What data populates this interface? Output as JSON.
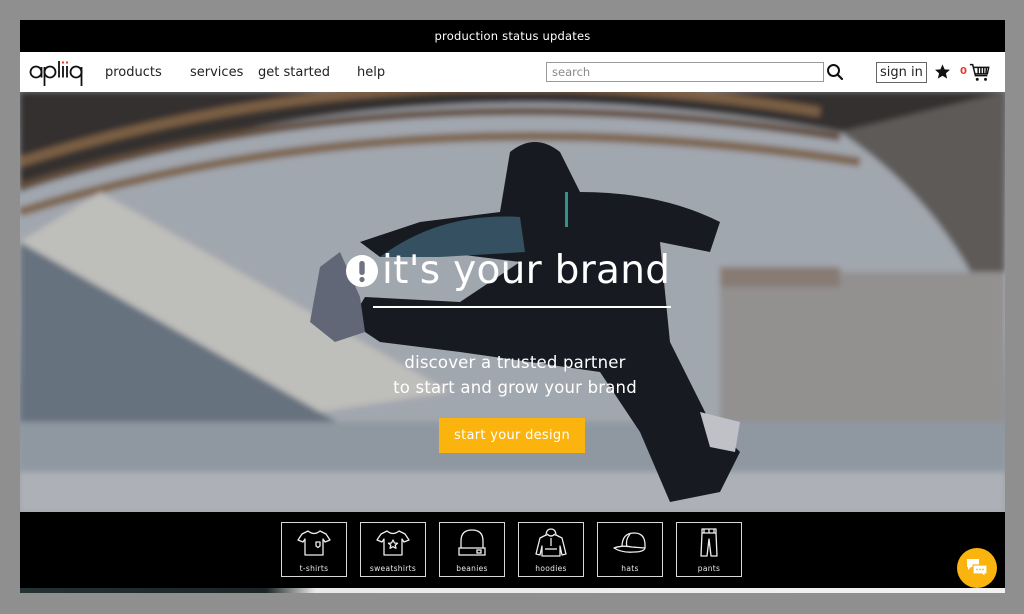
{
  "topbar": {
    "announcement": "production status updates"
  },
  "nav": {
    "logo_text": "apliiq",
    "links": [
      {
        "label": "products"
      },
      {
        "label": "services"
      },
      {
        "label": "get started"
      },
      {
        "label": "help"
      }
    ],
    "search_placeholder": "search",
    "search_value": "",
    "sign_in_label": "sign in",
    "favorites_icon": "star-icon",
    "cart_count": "0",
    "cart_icon": "cart-icon"
  },
  "hero": {
    "title": "it's your brand",
    "title_icon": "exclamation-circle-icon",
    "subtitle_line1": "discover a trusted partner",
    "subtitle_line2": "to start and grow your brand",
    "cta_label": "start your design"
  },
  "categories": [
    {
      "label": "t-shirts",
      "icon": "tshirt-icon"
    },
    {
      "label": "sweatshirts",
      "icon": "sweatshirt-icon"
    },
    {
      "label": "beanies",
      "icon": "beanie-icon"
    },
    {
      "label": "hoodies",
      "icon": "hoodie-icon"
    },
    {
      "label": "hats",
      "icon": "hat-icon"
    },
    {
      "label": "pants",
      "icon": "pants-icon"
    }
  ],
  "chat": {
    "icon": "chat-bubbles-icon"
  },
  "colors": {
    "accent": "#fbb40e",
    "cart_count": "#e53935",
    "topbar_bg": "#000000",
    "nav_bg": "#ffffff"
  }
}
